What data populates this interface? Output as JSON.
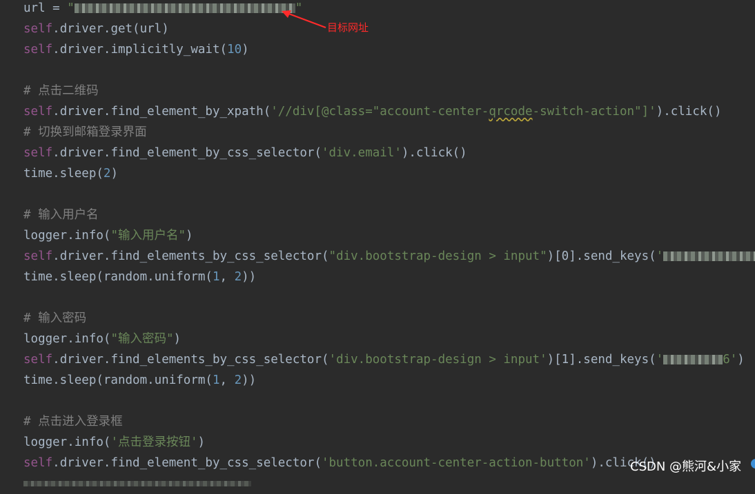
{
  "code": {
    "l1": {
      "pre": "url = ",
      "q1": "\"",
      "q2": "\""
    },
    "l2": {
      "self": "self",
      "rest": ".driver.get(url)"
    },
    "l3": {
      "self": "self",
      "rest": ".driver.implicitly_wait(",
      "num": "10",
      "end": ")"
    },
    "l5": {
      "text": "# 点击二维码"
    },
    "l6": {
      "self": "self",
      "rest": ".driver.find_element_by_xpath(",
      "s1": "'//div[@class=\"account-center-",
      "sq": "qrcode",
      "s2": "-switch-action\"]'",
      "end": ").click()"
    },
    "l7": {
      "text": "# 切换到邮箱登录界面"
    },
    "l8": {
      "self": "self",
      "rest": ".driver.find_element_by_css_selector(",
      "s": "'div.email'",
      "end": ").click()"
    },
    "l9": {
      "pre": "time.sleep(",
      "num": "2",
      "end": ")"
    },
    "l11": {
      "text": "# 输入用户名"
    },
    "l12": {
      "pre": "logger.info(",
      "s": "\"输入用户名\"",
      "end": ")"
    },
    "l13": {
      "self": "self",
      "rest": ".driver.find_elements_by_css_selector(",
      "s": "\"div.bootstrap-design > input\"",
      "mid": ")[0].send_keys(",
      "q1": "'",
      "q2": "'",
      "end": ")"
    },
    "l14": {
      "pre": "time.sleep(random.uniform(",
      "n1": "1",
      "comma": ", ",
      "n2": "2",
      "end": "))"
    },
    "l16": {
      "text": "# 输入密码"
    },
    "l17": {
      "pre": "logger.info(",
      "s": "\"输入密码\"",
      "end": ")"
    },
    "l18": {
      "self": "self",
      "rest": ".driver.find_elements_by_css_selector(",
      "s": "'div.bootstrap-design > input'",
      "mid": ")[1].send_keys(",
      "q1": "'",
      "tail": "6'",
      "end": ")"
    },
    "l19": {
      "pre": "time.sleep(random.uniform(",
      "n1": "1",
      "comma": ", ",
      "n2": "2",
      "end": "))"
    },
    "l21": {
      "text": "# 点击进入登录框"
    },
    "l22": {
      "pre": "logger.info(",
      "s": "'点击登录按钮'",
      "end": ")"
    },
    "l23": {
      "self": "self",
      "rest": ".driver.find_element_by_css_selector(",
      "s": "'button.account-center-action-button'",
      "end": ").click()"
    }
  },
  "annotation": {
    "label": "目标网址",
    "color": "#ff2b2b"
  },
  "watermark": {
    "text": "CSDN @熊河&小家"
  },
  "colors": {
    "background": "#2b2b2b",
    "default": "#a9b7c6",
    "self": "#94558d",
    "string": "#6a8759",
    "number": "#6897bb",
    "comment": "#808080"
  }
}
